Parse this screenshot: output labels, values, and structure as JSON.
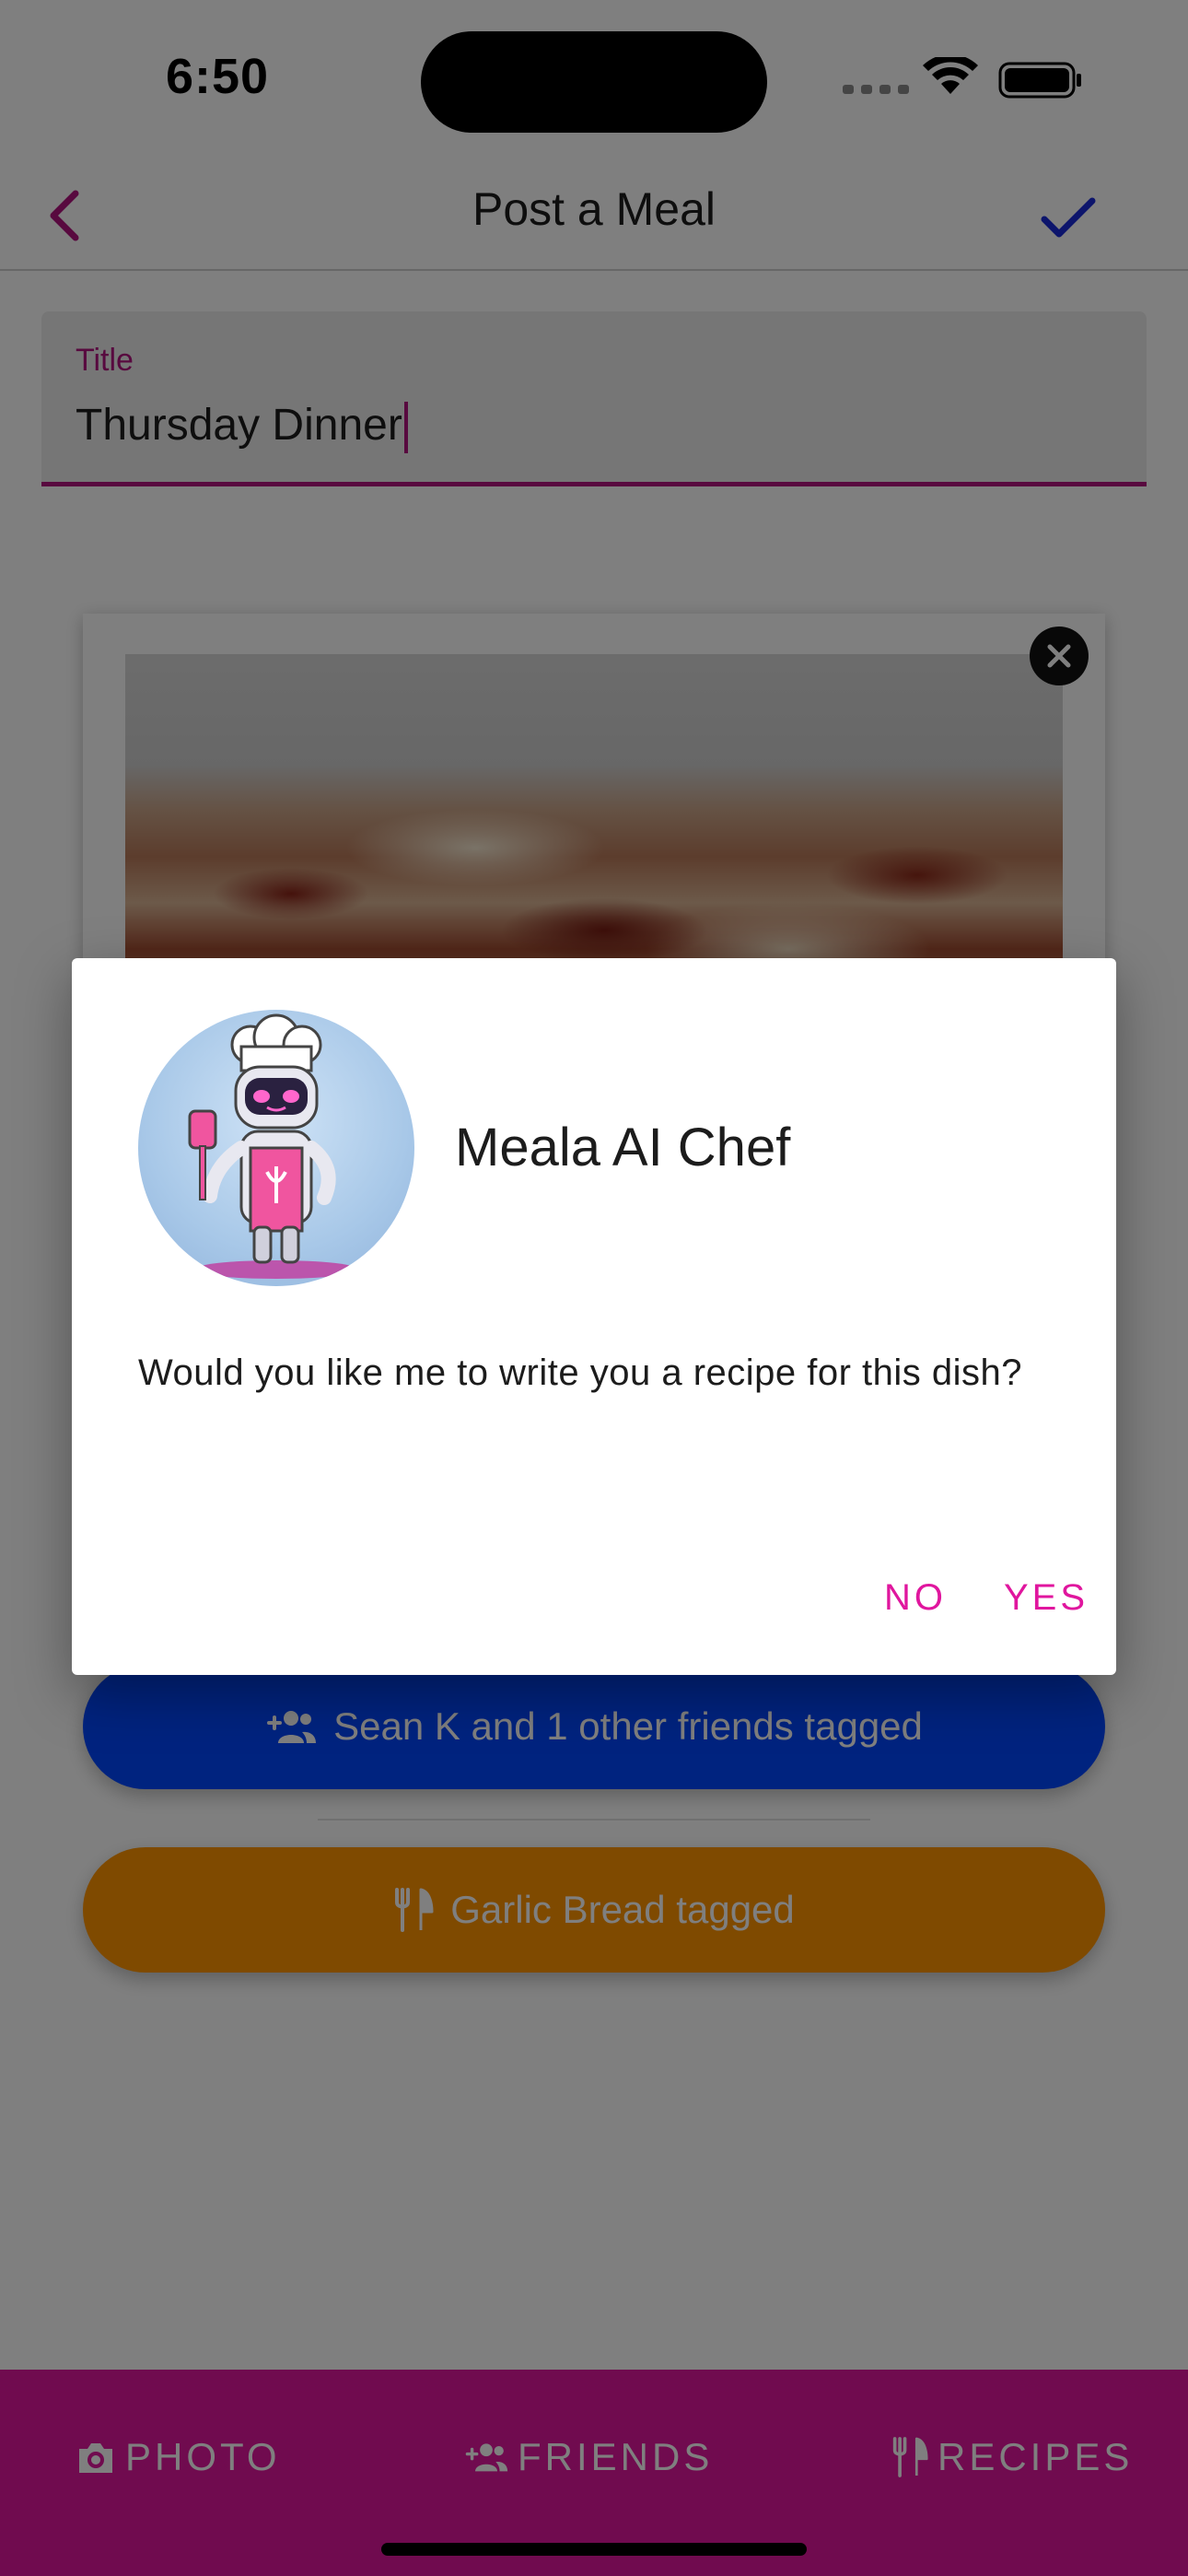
{
  "status_bar": {
    "time": "6:50"
  },
  "nav": {
    "title": "Post a Meal",
    "accent": "#b0127e",
    "confirm_color": "#1a2ad8"
  },
  "form": {
    "title_label": "Title",
    "title_value": "Thursday Dinner"
  },
  "tags": {
    "friends": "Sean K and 1 other friends tagged",
    "recipes": "Garlic Bread tagged",
    "friends_color": "#0047ff",
    "recipes_color": "#ff9500"
  },
  "bottom_tabs": [
    {
      "label": "PHOTO",
      "icon": "camera-icon"
    },
    {
      "label": "FRIENDS",
      "icon": "person-add-icon"
    },
    {
      "label": "RECIPES",
      "icon": "fork-knife-icon"
    }
  ],
  "dialog": {
    "title": "Meala AI Chef",
    "message": "Would you like me to write you a recipe for this dish?",
    "no_label": "NO",
    "yes_label": "YES",
    "avatar": "robot-chef-avatar",
    "button_color": "#e0169e"
  },
  "colors": {
    "brand": "#e0169e",
    "scrim": "rgba(0,0,0,0.5)"
  }
}
